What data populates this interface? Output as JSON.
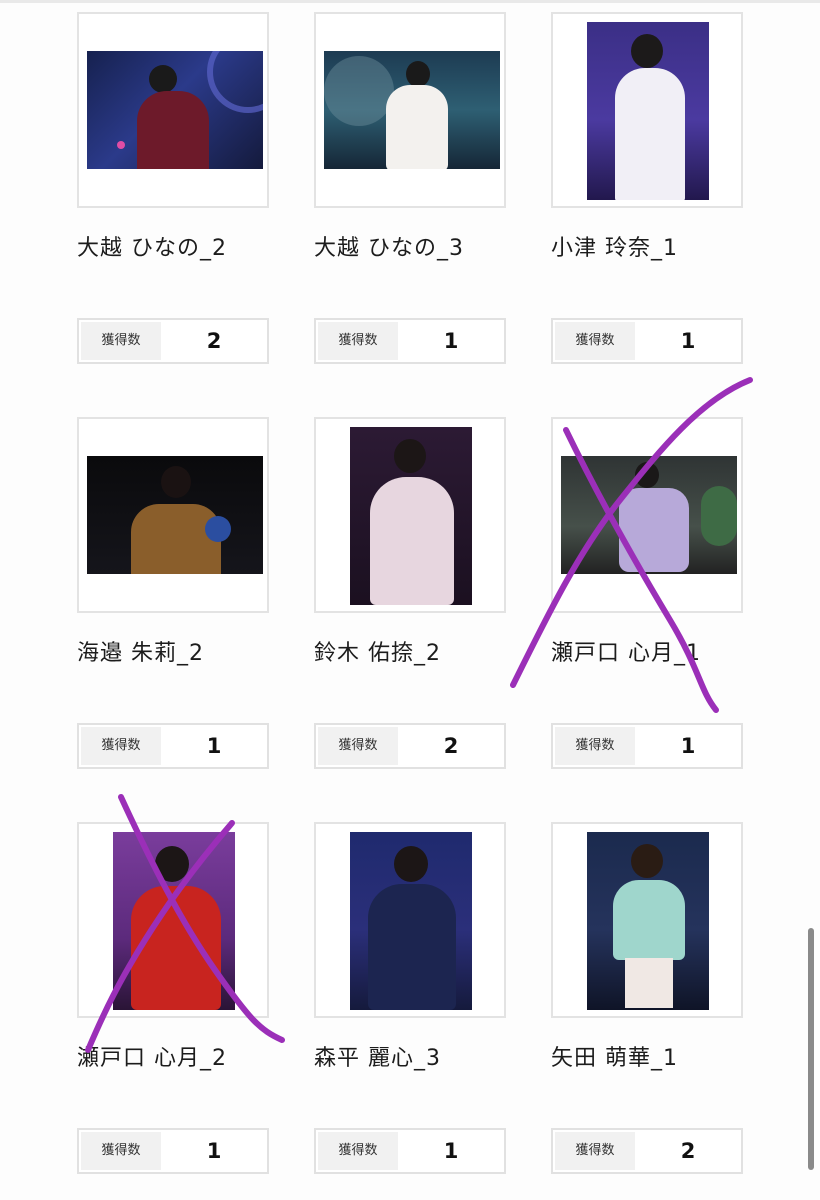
{
  "cards": [
    {
      "name": "大越 ひなの_2",
      "stat_label": "獲得数",
      "stat_value": "2",
      "photo": "concert-photo",
      "orientation": "landscape",
      "crossed_out": false
    },
    {
      "name": "大越 ひなの_3",
      "stat_label": "獲得数",
      "stat_value": "1",
      "photo": "concert-photo",
      "orientation": "landscape",
      "crossed_out": false
    },
    {
      "name": "小津 玲奈_1",
      "stat_label": "獲得数",
      "stat_value": "1",
      "photo": "concert-photo",
      "orientation": "portrait",
      "crossed_out": false
    },
    {
      "name": "海邉 朱莉_2",
      "stat_label": "獲得数",
      "stat_value": "1",
      "photo": "concert-photo",
      "orientation": "landscape",
      "crossed_out": false
    },
    {
      "name": "鈴木 佑捺_2",
      "stat_label": "獲得数",
      "stat_value": "2",
      "photo": "concert-photo",
      "orientation": "portrait",
      "crossed_out": false
    },
    {
      "name": "瀬戸口 心月_1",
      "stat_label": "獲得数",
      "stat_value": "1",
      "photo": "concert-photo",
      "orientation": "landscape",
      "crossed_out": true
    },
    {
      "name": "瀬戸口 心月_2",
      "stat_label": "獲得数",
      "stat_value": "1",
      "photo": "concert-photo",
      "orientation": "portrait",
      "crossed_out": true
    },
    {
      "name": "森平 麗心_3",
      "stat_label": "獲得数",
      "stat_value": "1",
      "photo": "concert-photo",
      "orientation": "portrait",
      "crossed_out": false
    },
    {
      "name": "矢田 萌華_1",
      "stat_label": "獲得数",
      "stat_value": "2",
      "photo": "concert-photo",
      "orientation": "portrait",
      "crossed_out": false
    }
  ],
  "colors": {
    "cross_mark": "#9b2fb8",
    "frame_border": "#e3e3e3",
    "label_bg": "#f1f1f1"
  }
}
